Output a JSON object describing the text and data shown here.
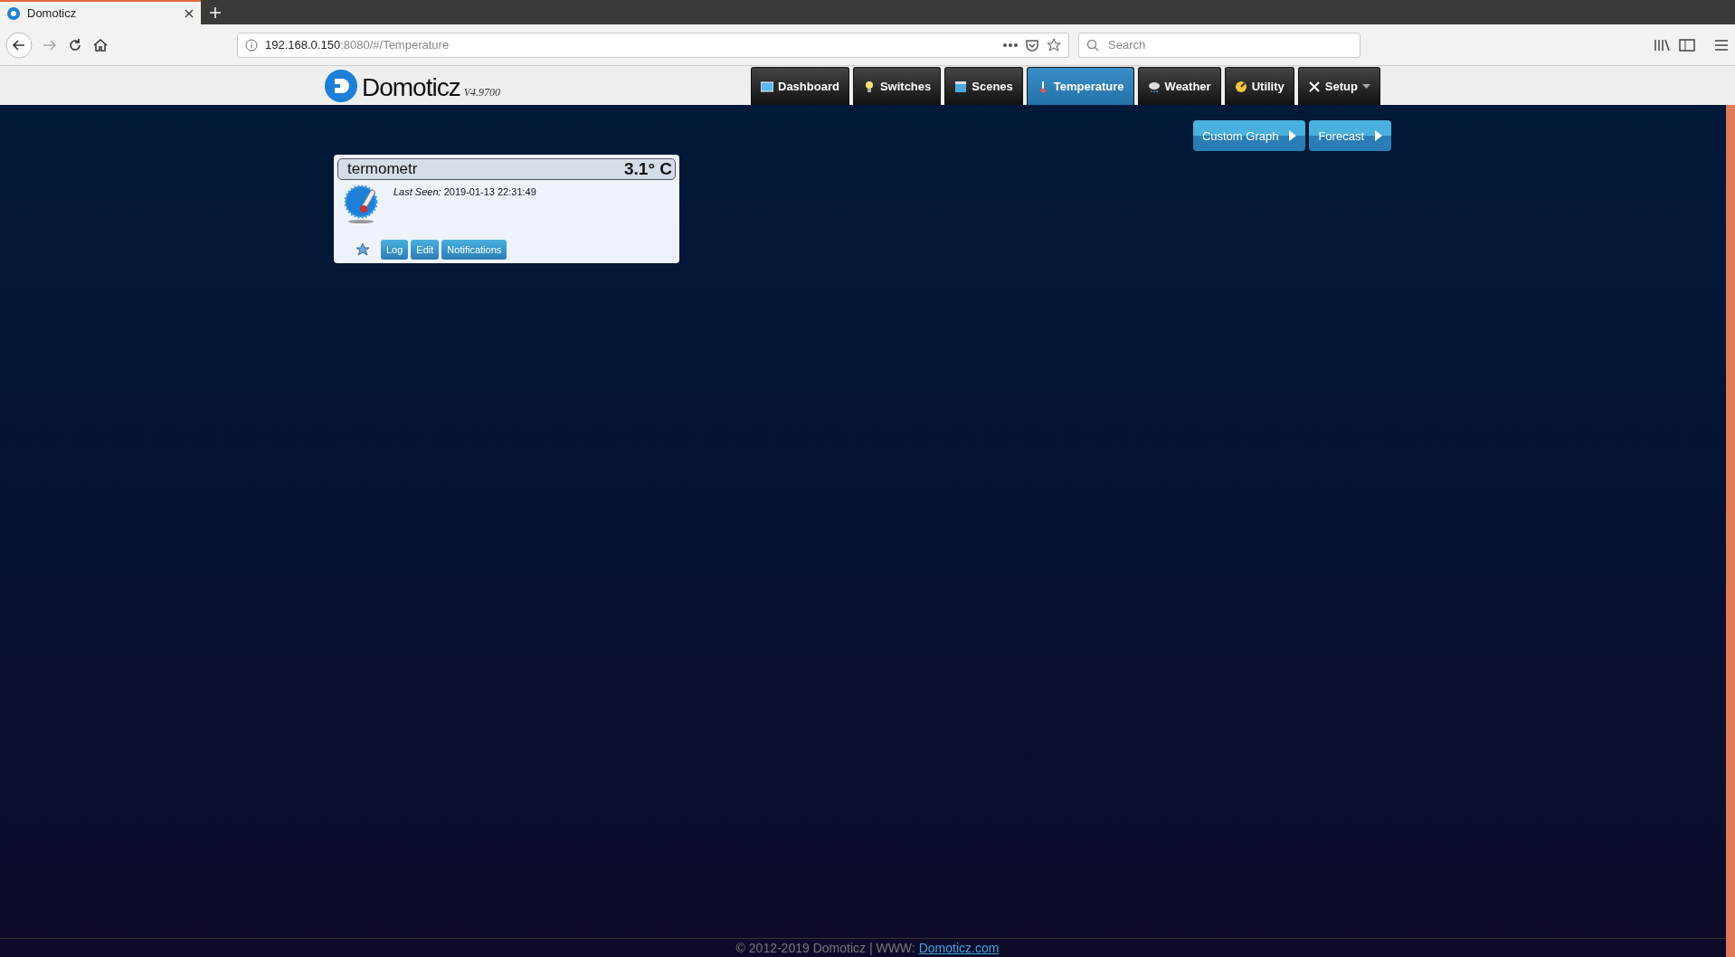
{
  "browser": {
    "tab": {
      "title": "Domoticz"
    },
    "url": {
      "host": "192.168.0.150",
      "rest": ":8080/#/Temperature"
    },
    "search": {
      "placeholder": "Search"
    }
  },
  "header": {
    "logo": "Domoticz",
    "version": "V4.9700",
    "nav": [
      {
        "label": "Dashboard",
        "kind": "dashboard",
        "selected": false,
        "has_menu": false
      },
      {
        "label": "Switches",
        "kind": "switches",
        "selected": false,
        "has_menu": false
      },
      {
        "label": "Scenes",
        "kind": "scenes",
        "selected": false,
        "has_menu": false
      },
      {
        "label": "Temperature",
        "kind": "temperature",
        "selected": true,
        "has_menu": false
      },
      {
        "label": "Weather",
        "kind": "weather",
        "selected": false,
        "has_menu": false
      },
      {
        "label": "Utility",
        "kind": "utility",
        "selected": false,
        "has_menu": false
      },
      {
        "label": "Setup",
        "kind": "setup",
        "selected": false,
        "has_menu": true
      }
    ]
  },
  "actions": [
    "Custom Graph",
    "Forecast"
  ],
  "devices": [
    {
      "name": "termometr",
      "value": "3.1° C",
      "last_seen_label": "Last Seen:",
      "last_seen": "2019-01-13 22:31:49",
      "buttons": [
        "Log",
        "Edit",
        "Notifications"
      ]
    }
  ],
  "footer": {
    "text": "© 2012-2019 Domoticz | WWW:",
    "link": "Domoticz.com"
  }
}
